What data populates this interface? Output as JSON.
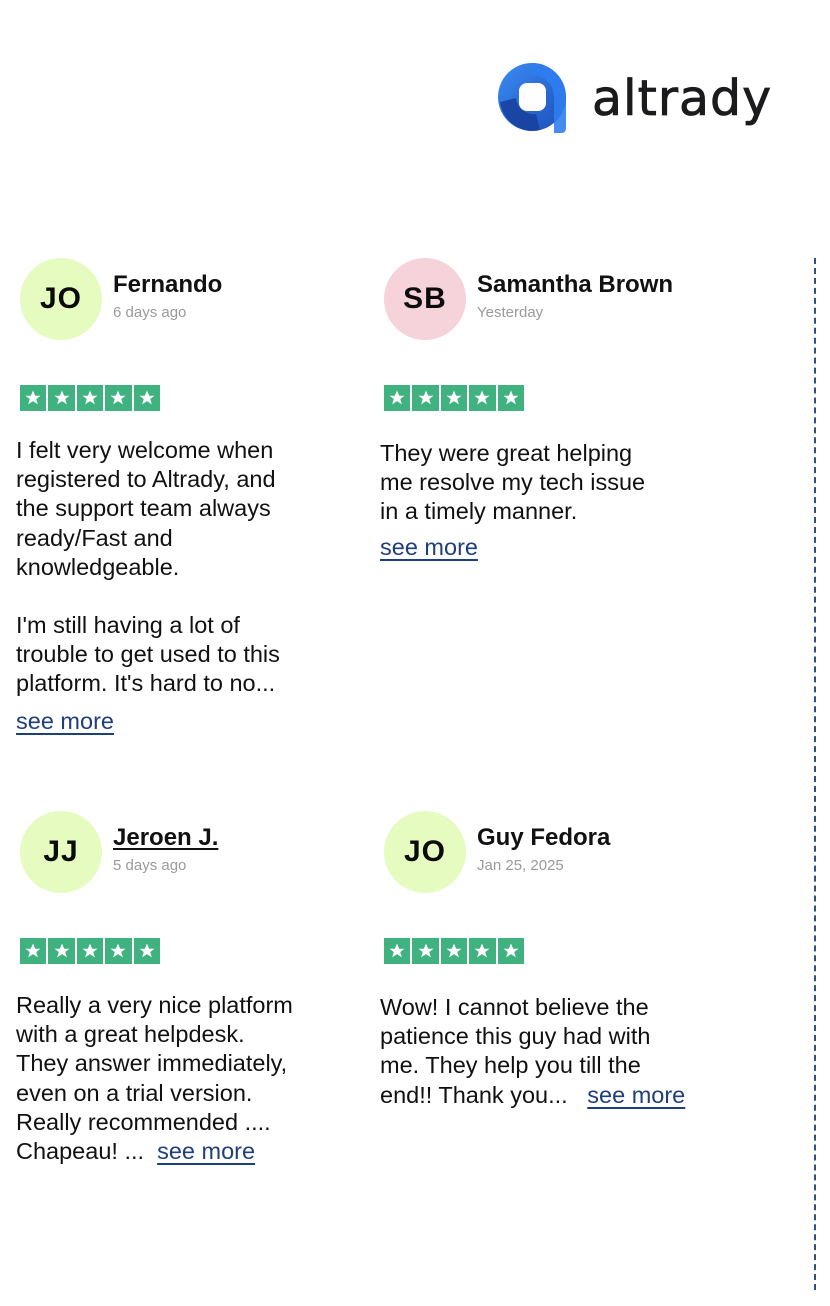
{
  "brand": {
    "name": "altrady",
    "mark_color": "#2a6fe0"
  },
  "colors": {
    "star_green": "#3fb27f",
    "link": "#1f3f7a"
  },
  "reviews": [
    {
      "initials": "JO",
      "avatar_color": "#e6fbbf",
      "name": "Fernando",
      "date": "6 days ago",
      "rating": 5,
      "text_1": "I felt very welcome when\nregistered to Altrady, and\nthe support team always\nready/Fast and\nknowledgeable.",
      "text_2": "I'm still having a lot of\ntrouble to get used to this\nplatform. It's hard to no...",
      "see_more": "see more"
    },
    {
      "initials": "SB",
      "avatar_color": "#f6d2da",
      "name": "Samantha Brown",
      "date": "Yesterday",
      "rating": 5,
      "text_1": "They were great helping\nme resolve my tech issue\nin a timely manner.",
      "see_more": "see more"
    },
    {
      "initials": "JJ",
      "avatar_color": "#e6fbbf",
      "name": "Jeroen J.",
      "date": "5 days ago",
      "rating": 5,
      "text_1": "Really a very nice platform\nwith a great helpdesk.\nThey answer immediately,\neven on a trial version.\nReally recommended ....",
      "text_last": "Chapeau! ...",
      "see_more": "see more"
    },
    {
      "initials": "JO",
      "avatar_color": "#e6fbbf",
      "name": "Guy Fedora",
      "date": "Jan 25, 2025",
      "rating": 5,
      "text_1": "Wow! I cannot believe the\npatience this guy had with\nme. They help you till the",
      "text_last": "end!! Thank you...",
      "see_more": "see more"
    }
  ]
}
